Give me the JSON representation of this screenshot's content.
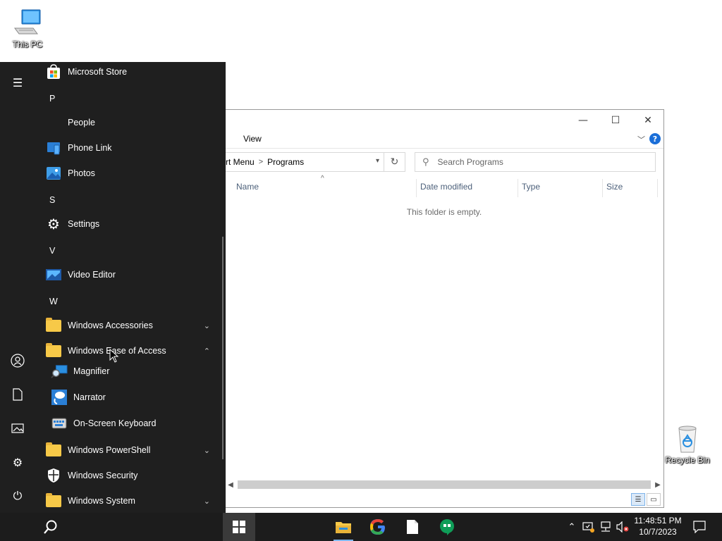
{
  "desktop": {
    "icons": [
      {
        "label": "This PC",
        "icon": "monitor-icon"
      },
      {
        "label": "Recycle Bin",
        "icon": "recycle-bin-icon"
      }
    ]
  },
  "explorer": {
    "ribbon_tab": "View",
    "breadcrumb": [
      "rt Menu",
      "Programs"
    ],
    "search_placeholder": "Search Programs",
    "columns": [
      "Name",
      "Date modified",
      "Type",
      "Size"
    ],
    "empty_message": "This folder is empty.",
    "window_buttons": {
      "minimize": "—",
      "maximize": "☐",
      "close": "✕"
    }
  },
  "start_menu": {
    "rail": [
      "menu-icon",
      "user-icon",
      "documents-icon",
      "pictures-icon",
      "settings-icon",
      "power-icon"
    ],
    "items": [
      {
        "type": "app",
        "label": "Microsoft Store",
        "icon": "store-icon"
      },
      {
        "type": "letter",
        "label": "P"
      },
      {
        "type": "app",
        "label": "People",
        "icon": "people-icon"
      },
      {
        "type": "app",
        "label": "Phone Link",
        "icon": "phone-link-icon"
      },
      {
        "type": "app",
        "label": "Photos",
        "icon": "photos-icon"
      },
      {
        "type": "letter",
        "label": "S"
      },
      {
        "type": "app",
        "label": "Settings",
        "icon": "gear-icon"
      },
      {
        "type": "letter",
        "label": "V"
      },
      {
        "type": "app",
        "label": "Video Editor",
        "icon": "video-editor-icon"
      },
      {
        "type": "letter",
        "label": "W"
      },
      {
        "type": "folder",
        "label": "Windows Accessories",
        "expanded": false
      },
      {
        "type": "folder",
        "label": "Windows Ease of Access",
        "expanded": true
      },
      {
        "type": "subapp",
        "label": "Magnifier",
        "icon": "magnifier-icon"
      },
      {
        "type": "subapp",
        "label": "Narrator",
        "icon": "narrator-icon"
      },
      {
        "type": "subapp",
        "label": "On-Screen Keyboard",
        "icon": "keyboard-icon"
      },
      {
        "type": "folder",
        "label": "Windows PowerShell",
        "expanded": false
      },
      {
        "type": "app",
        "label": "Windows Security",
        "icon": "shield-icon"
      },
      {
        "type": "folder",
        "label": "Windows System",
        "expanded": false
      }
    ]
  },
  "taskbar": {
    "apps": [
      "file-explorer-icon",
      "google-chrome-icon",
      "notepad-icon",
      "hangouts-icon"
    ],
    "clock": {
      "time": "11:48:51 PM",
      "date": "10/7/2023"
    }
  },
  "colors": {
    "start_bg": "#1f1f1f",
    "taskbar_bg": "#1c1c1c",
    "folder": "#f7c948",
    "accent": "#1a6ed8"
  }
}
